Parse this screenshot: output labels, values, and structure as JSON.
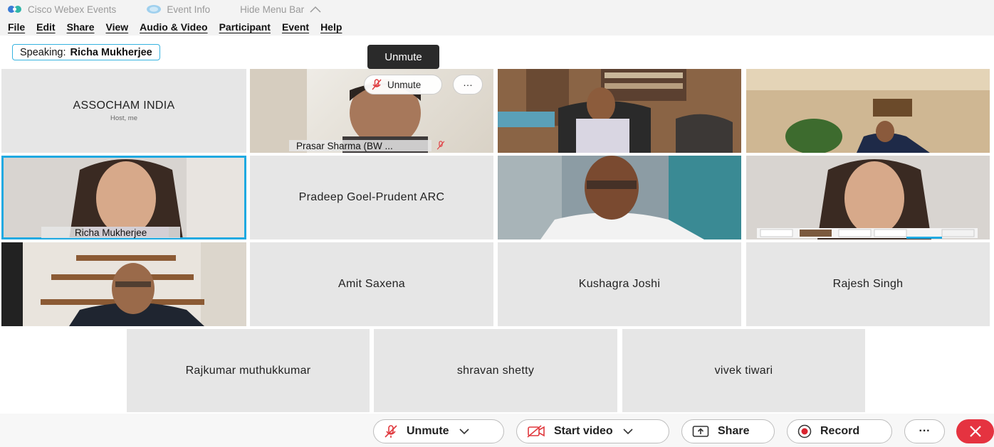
{
  "titlebar": {
    "app_name": "Cisco Webex Events",
    "event_info": "Event Info",
    "hide_menu": "Hide Menu Bar"
  },
  "menu": [
    "File",
    "Edit",
    "Share",
    "View",
    "Audio & Video",
    "Participant",
    "Event",
    "Help"
  ],
  "speaking": {
    "label": "Speaking:",
    "name": "Richa Mukherjee"
  },
  "tooltip": "Unmute",
  "tiles": {
    "assocham": {
      "name": "ASSOCHAM INDIA",
      "sub": "Host, me"
    },
    "prasar": {
      "name": "Prasar Sharma (BW ...",
      "unmute": "Unmute"
    },
    "richa": {
      "name": "Richa Mukherjee"
    },
    "pradeep": {
      "name": "Pradeep Goel-Prudent ARC"
    },
    "amit": {
      "name": "Amit Saxena"
    },
    "kushagra": {
      "name": "Kushagra Joshi"
    },
    "rajesh": {
      "name": "Rajesh Singh"
    },
    "rajkumar": {
      "name": "Rajkumar muthukkumar"
    },
    "shravan": {
      "name": "shravan shetty"
    },
    "vivek": {
      "name": "vivek tiwari"
    }
  },
  "controls": {
    "unmute": "Unmute",
    "start_video": "Start video",
    "share": "Share",
    "record": "Record",
    "more": "···"
  },
  "colors": {
    "accent": "#1fa9e1",
    "end": "#e53340",
    "muted_red": "#e0393e"
  }
}
